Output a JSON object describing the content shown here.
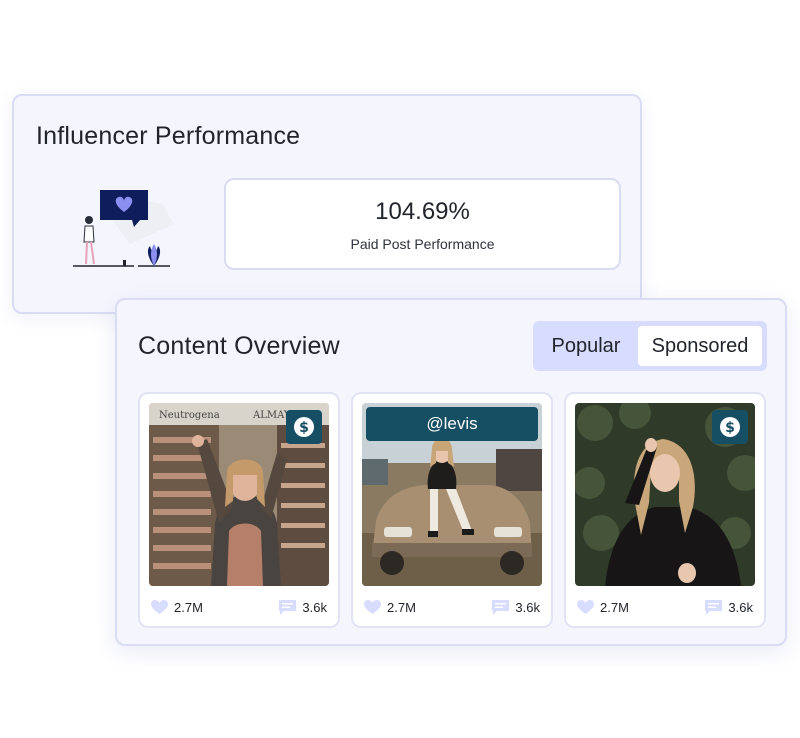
{
  "performance": {
    "title": "Influencer Performance",
    "metric": {
      "value": "104.69%",
      "label": "Paid Post Performance"
    },
    "illustration": "woman-with-heart-speech-bubble"
  },
  "content": {
    "title": "Content Overview",
    "toggle": {
      "options": [
        "Popular",
        "Sponsored"
      ],
      "selected": "Sponsored"
    },
    "posts": [
      {
        "badge_icon": "dollar-icon",
        "handle": "",
        "likes": "2.7M",
        "comments": "3.6k"
      },
      {
        "badge_icon": "",
        "handle": "@levis",
        "likes": "2.7M",
        "comments": "3.6k"
      },
      {
        "badge_icon": "dollar-icon",
        "handle": "",
        "likes": "2.7M",
        "comments": "3.6k"
      }
    ]
  },
  "colors": {
    "accent": "#164e63",
    "toggle_bg": "#d8dcff",
    "stat_icon": "#d8dcff",
    "card_bg": "#f5f6fd",
    "card_border": "#d9dcf3"
  }
}
